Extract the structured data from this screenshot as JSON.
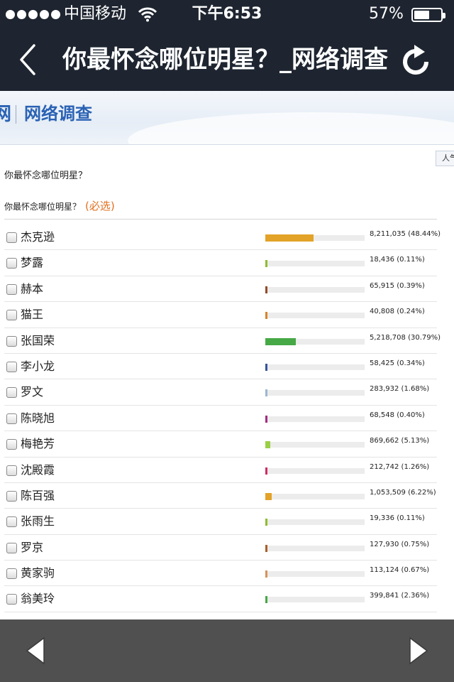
{
  "status_bar": {
    "carrier": "中国移动",
    "time": "下午6:53",
    "battery_percent_label": "57%",
    "battery_level": 0.57,
    "signal_dots": 5
  },
  "nav": {
    "title": "你最怀念哪位明星？_网络调查",
    "back_icon": "chevron-left-icon",
    "refresh_icon": "refresh-icon"
  },
  "banner": {
    "site_fragment": "网",
    "section_title": "网络调查"
  },
  "side_tab_fragment": "人气",
  "question": "你最怀念哪位明星？",
  "poll": {
    "prompt": "你最怀念哪位明星？",
    "required_label": "(必选)",
    "options": [
      {
        "name": "杰克逊",
        "votes": "8,211,035",
        "percent_label": "(48.44%)",
        "share": 48.44,
        "color": "#f6b12c"
      },
      {
        "name": "梦露",
        "votes": "18,436",
        "percent_label": "(0.11%)",
        "share": 0.11,
        "color": "#9acd32"
      },
      {
        "name": "赫本",
        "votes": "65,915",
        "percent_label": "(0.39%)",
        "share": 0.39,
        "color": "#a0522d"
      },
      {
        "name": "猫王",
        "votes": "40,808",
        "percent_label": "(0.24%)",
        "share": 0.24,
        "color": "#e8912e"
      },
      {
        "name": "张国荣",
        "votes": "5,218,708",
        "percent_label": "(30.79%)",
        "share": 30.79,
        "color": "#4cb84c"
      },
      {
        "name": "李小龙",
        "votes": "58,425",
        "percent_label": "(0.34%)",
        "share": 0.34,
        "color": "#3c5aa8"
      },
      {
        "name": "罗文",
        "votes": "283,932",
        "percent_label": "(1.68%)",
        "share": 1.68,
        "color": "#a8c8e4"
      },
      {
        "name": "陈晓旭",
        "votes": "68,548",
        "percent_label": "(0.40%)",
        "share": 0.4,
        "color": "#b0308c"
      },
      {
        "name": "梅艳芳",
        "votes": "869,662",
        "percent_label": "(5.13%)",
        "share": 5.13,
        "color": "#a6e24a"
      },
      {
        "name": "沈殿霞",
        "votes": "212,742",
        "percent_label": "(1.26%)",
        "share": 1.26,
        "color": "#e0306a"
      },
      {
        "name": "陈百强",
        "votes": "1,053,509",
        "percent_label": "(6.22%)",
        "share": 6.22,
        "color": "#f6b12c"
      },
      {
        "name": "张雨生",
        "votes": "19,336",
        "percent_label": "(0.11%)",
        "share": 0.11,
        "color": "#9acd32"
      },
      {
        "name": "罗京",
        "votes": "127,930",
        "percent_label": "(0.75%)",
        "share": 0.75,
        "color": "#b8682a"
      },
      {
        "name": "黄家驹",
        "votes": "113,124",
        "percent_label": "(0.67%)",
        "share": 0.67,
        "color": "#e8a060"
      },
      {
        "name": "翁美玲",
        "votes": "399,841",
        "percent_label": "(2.36%)",
        "share": 2.36,
        "color": "#4cb84c"
      }
    ]
  },
  "toolbar": {
    "prev_icon": "triangle-left-icon",
    "next_icon": "triangle-right-icon"
  }
}
